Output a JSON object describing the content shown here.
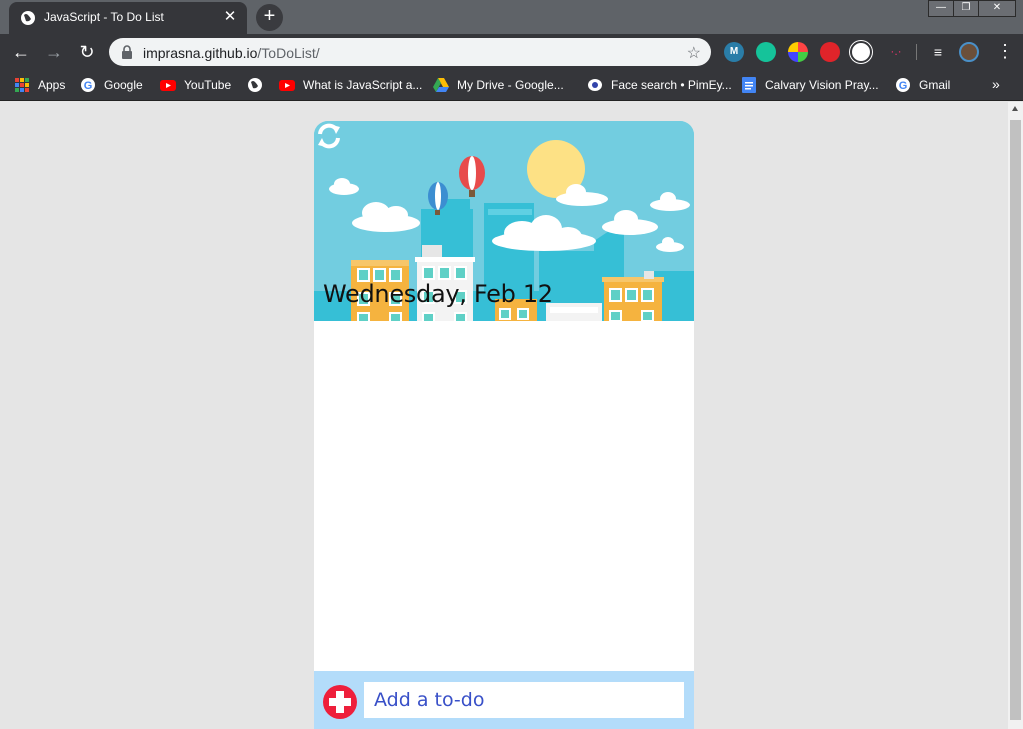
{
  "browser": {
    "tab": {
      "title": "JavaScript - To Do List",
      "close_label": "✕",
      "favicon": "globe-icon"
    },
    "new_tab_label": "+",
    "window_controls": {
      "minimize": "—",
      "maximize": "❐",
      "close": "✕"
    },
    "nav": {
      "back": "←",
      "forward": "→",
      "reload": "↻"
    },
    "url": {
      "host": "imprasna.github.io",
      "path": "/ToDoList/"
    },
    "star": "☆",
    "menu": "⋮",
    "extensions": [
      "mercury-icon",
      "grammarly-icon",
      "colorpick-icon",
      "adblock-hand-icon",
      "devtools-icon",
      "dots-icon",
      "media-queue-icon",
      "profile-avatar"
    ]
  },
  "bookmarks": [
    {
      "label": "Apps",
      "icon": "apps-grid-icon"
    },
    {
      "label": "Google",
      "icon": "google-icon"
    },
    {
      "label": "YouTube",
      "icon": "youtube-icon"
    },
    {
      "label": "",
      "icon": "globe-icon"
    },
    {
      "label": "What is JavaScript a...",
      "icon": "youtube-icon"
    },
    {
      "label": "My Drive - Google...",
      "icon": "drive-icon"
    },
    {
      "label": "Face search • PimEy...",
      "icon": "eye-icon"
    },
    {
      "label": "Calvary Vision Pray...",
      "icon": "docs-icon"
    },
    {
      "label": "Gmail",
      "icon": "google-icon"
    }
  ],
  "bookmarks_more": "»",
  "app": {
    "date": "Wednesday, Feb 12",
    "refresh_icon": "refresh-icon",
    "add_placeholder": "Add a to-do",
    "add_icon": "plus-circle-icon",
    "colors": {
      "sky": "#72cde0",
      "add_bar": "#b3dcfa",
      "add_button": "#ee1f3b",
      "placeholder": "#3950c8"
    }
  }
}
